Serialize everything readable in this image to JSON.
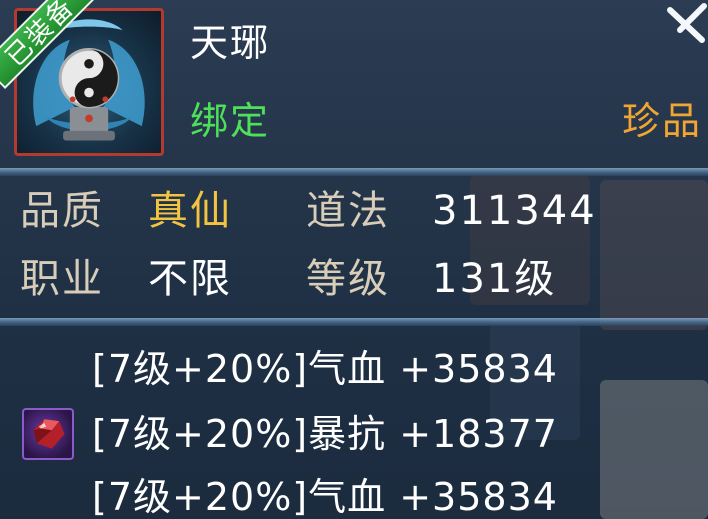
{
  "item": {
    "equipped_label": "已装备",
    "name": "天琊",
    "bind_status": "绑定",
    "rarity": "珍品",
    "icon": "taiji-artifact-icon"
  },
  "stats": {
    "quality_label": "品质",
    "quality_value": "真仙",
    "daofa_label": "道法",
    "daofa_value": "311344",
    "class_label": "职业",
    "class_value": "不限",
    "level_label": "等级",
    "level_value": "131级"
  },
  "gems": {
    "icon": "red-gem-icon",
    "rows": [
      {
        "text": "[7级+20%]气血 +35834"
      },
      {
        "text": "[7级+20%]暴抗 +18377"
      },
      {
        "text": "[7级+20%]气血 +35834"
      }
    ]
  },
  "colors": {
    "name": "#ffffff",
    "bind": "#4fe05a",
    "rarity": "#f1a533",
    "quality_value": "#f3c440",
    "label": "#d7cdb8",
    "equipped_ribbon": "#2fa13c",
    "frame_border": "#b23a2e"
  }
}
